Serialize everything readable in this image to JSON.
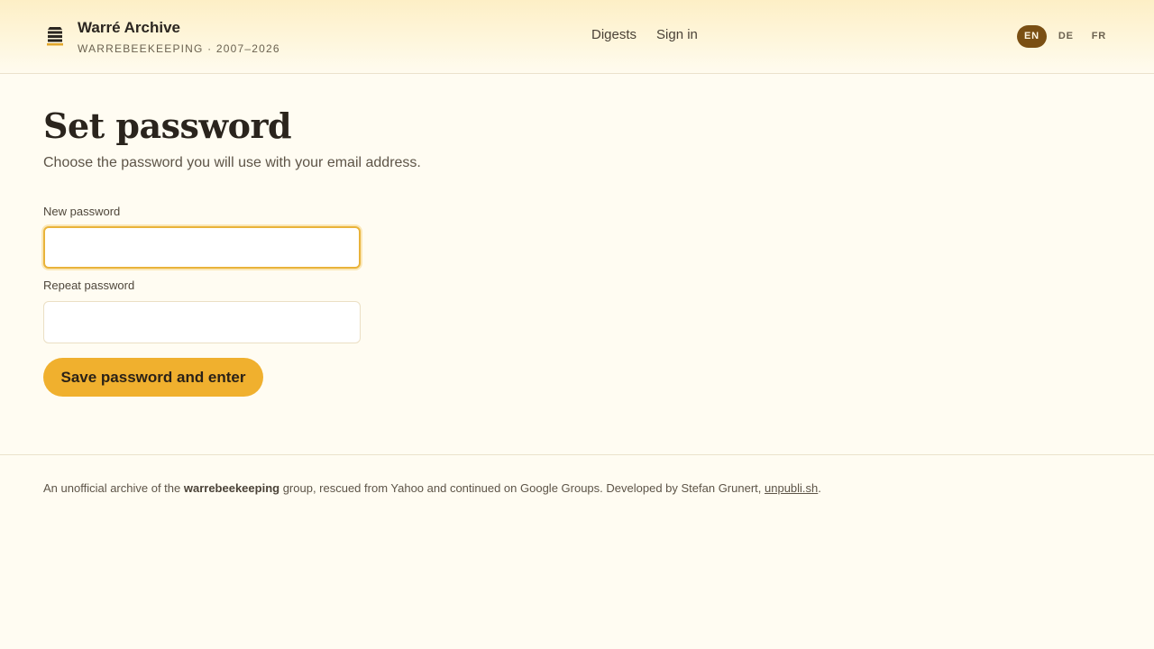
{
  "header": {
    "title": "Warré Archive",
    "subtitle": "WARREBEEKEEPING · 2007–2026",
    "logo_icon": "beehive-icon",
    "nav": [
      {
        "label": "Digests"
      },
      {
        "label": "Sign in"
      }
    ],
    "languages": [
      {
        "code": "EN",
        "active": true
      },
      {
        "code": "DE",
        "active": false
      },
      {
        "code": "FR",
        "active": false
      }
    ]
  },
  "main": {
    "title": "Set password",
    "subtitle": "Choose the password you will use with your email address.",
    "new_password": {
      "label": "New password",
      "value": "",
      "focused": true
    },
    "repeat_password": {
      "label": "Repeat password",
      "value": ""
    },
    "submit_label": "Save password and enter"
  },
  "footer": {
    "text_before": "An unofficial archive of the ",
    "group_name": "warrebeekeeping",
    "text_middle": " group, rescued from Yahoo and continued on Google Groups. Developed by Stefan Grunert, ",
    "link_text": "unpubli.sh",
    "text_after": "."
  },
  "colors": {
    "accent": "#f0b02e",
    "active_lang": "#7a4f13",
    "background": "#fffcf2"
  }
}
